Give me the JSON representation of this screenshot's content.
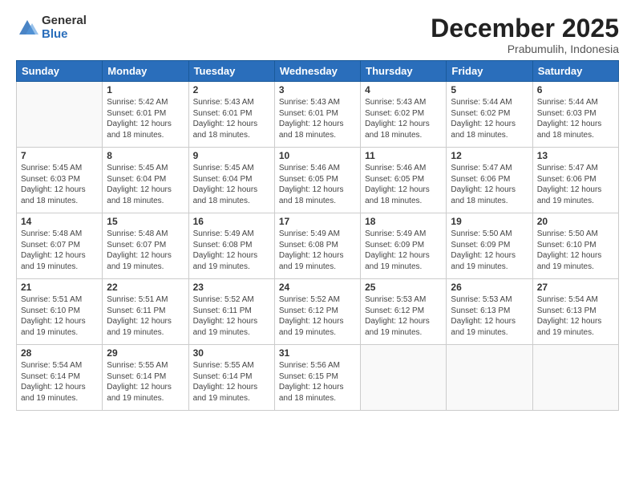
{
  "logo": {
    "general": "General",
    "blue": "Blue"
  },
  "header": {
    "title": "December 2025",
    "subtitle": "Prabumulih, Indonesia"
  },
  "days_of_week": [
    "Sunday",
    "Monday",
    "Tuesday",
    "Wednesday",
    "Thursday",
    "Friday",
    "Saturday"
  ],
  "weeks": [
    [
      {
        "day": "",
        "sunrise": "",
        "sunset": "",
        "daylight": ""
      },
      {
        "day": "1",
        "sunrise": "Sunrise: 5:42 AM",
        "sunset": "Sunset: 6:01 PM",
        "daylight": "Daylight: 12 hours and 18 minutes."
      },
      {
        "day": "2",
        "sunrise": "Sunrise: 5:43 AM",
        "sunset": "Sunset: 6:01 PM",
        "daylight": "Daylight: 12 hours and 18 minutes."
      },
      {
        "day": "3",
        "sunrise": "Sunrise: 5:43 AM",
        "sunset": "Sunset: 6:01 PM",
        "daylight": "Daylight: 12 hours and 18 minutes."
      },
      {
        "day": "4",
        "sunrise": "Sunrise: 5:43 AM",
        "sunset": "Sunset: 6:02 PM",
        "daylight": "Daylight: 12 hours and 18 minutes."
      },
      {
        "day": "5",
        "sunrise": "Sunrise: 5:44 AM",
        "sunset": "Sunset: 6:02 PM",
        "daylight": "Daylight: 12 hours and 18 minutes."
      },
      {
        "day": "6",
        "sunrise": "Sunrise: 5:44 AM",
        "sunset": "Sunset: 6:03 PM",
        "daylight": "Daylight: 12 hours and 18 minutes."
      }
    ],
    [
      {
        "day": "7",
        "sunrise": "Sunrise: 5:45 AM",
        "sunset": "Sunset: 6:03 PM",
        "daylight": "Daylight: 12 hours and 18 minutes."
      },
      {
        "day": "8",
        "sunrise": "Sunrise: 5:45 AM",
        "sunset": "Sunset: 6:04 PM",
        "daylight": "Daylight: 12 hours and 18 minutes."
      },
      {
        "day": "9",
        "sunrise": "Sunrise: 5:45 AM",
        "sunset": "Sunset: 6:04 PM",
        "daylight": "Daylight: 12 hours and 18 minutes."
      },
      {
        "day": "10",
        "sunrise": "Sunrise: 5:46 AM",
        "sunset": "Sunset: 6:05 PM",
        "daylight": "Daylight: 12 hours and 18 minutes."
      },
      {
        "day": "11",
        "sunrise": "Sunrise: 5:46 AM",
        "sunset": "Sunset: 6:05 PM",
        "daylight": "Daylight: 12 hours and 18 minutes."
      },
      {
        "day": "12",
        "sunrise": "Sunrise: 5:47 AM",
        "sunset": "Sunset: 6:06 PM",
        "daylight": "Daylight: 12 hours and 18 minutes."
      },
      {
        "day": "13",
        "sunrise": "Sunrise: 5:47 AM",
        "sunset": "Sunset: 6:06 PM",
        "daylight": "Daylight: 12 hours and 19 minutes."
      }
    ],
    [
      {
        "day": "14",
        "sunrise": "Sunrise: 5:48 AM",
        "sunset": "Sunset: 6:07 PM",
        "daylight": "Daylight: 12 hours and 19 minutes."
      },
      {
        "day": "15",
        "sunrise": "Sunrise: 5:48 AM",
        "sunset": "Sunset: 6:07 PM",
        "daylight": "Daylight: 12 hours and 19 minutes."
      },
      {
        "day": "16",
        "sunrise": "Sunrise: 5:49 AM",
        "sunset": "Sunset: 6:08 PM",
        "daylight": "Daylight: 12 hours and 19 minutes."
      },
      {
        "day": "17",
        "sunrise": "Sunrise: 5:49 AM",
        "sunset": "Sunset: 6:08 PM",
        "daylight": "Daylight: 12 hours and 19 minutes."
      },
      {
        "day": "18",
        "sunrise": "Sunrise: 5:49 AM",
        "sunset": "Sunset: 6:09 PM",
        "daylight": "Daylight: 12 hours and 19 minutes."
      },
      {
        "day": "19",
        "sunrise": "Sunrise: 5:50 AM",
        "sunset": "Sunset: 6:09 PM",
        "daylight": "Daylight: 12 hours and 19 minutes."
      },
      {
        "day": "20",
        "sunrise": "Sunrise: 5:50 AM",
        "sunset": "Sunset: 6:10 PM",
        "daylight": "Daylight: 12 hours and 19 minutes."
      }
    ],
    [
      {
        "day": "21",
        "sunrise": "Sunrise: 5:51 AM",
        "sunset": "Sunset: 6:10 PM",
        "daylight": "Daylight: 12 hours and 19 minutes."
      },
      {
        "day": "22",
        "sunrise": "Sunrise: 5:51 AM",
        "sunset": "Sunset: 6:11 PM",
        "daylight": "Daylight: 12 hours and 19 minutes."
      },
      {
        "day": "23",
        "sunrise": "Sunrise: 5:52 AM",
        "sunset": "Sunset: 6:11 PM",
        "daylight": "Daylight: 12 hours and 19 minutes."
      },
      {
        "day": "24",
        "sunrise": "Sunrise: 5:52 AM",
        "sunset": "Sunset: 6:12 PM",
        "daylight": "Daylight: 12 hours and 19 minutes."
      },
      {
        "day": "25",
        "sunrise": "Sunrise: 5:53 AM",
        "sunset": "Sunset: 6:12 PM",
        "daylight": "Daylight: 12 hours and 19 minutes."
      },
      {
        "day": "26",
        "sunrise": "Sunrise: 5:53 AM",
        "sunset": "Sunset: 6:13 PM",
        "daylight": "Daylight: 12 hours and 19 minutes."
      },
      {
        "day": "27",
        "sunrise": "Sunrise: 5:54 AM",
        "sunset": "Sunset: 6:13 PM",
        "daylight": "Daylight: 12 hours and 19 minutes."
      }
    ],
    [
      {
        "day": "28",
        "sunrise": "Sunrise: 5:54 AM",
        "sunset": "Sunset: 6:14 PM",
        "daylight": "Daylight: 12 hours and 19 minutes."
      },
      {
        "day": "29",
        "sunrise": "Sunrise: 5:55 AM",
        "sunset": "Sunset: 6:14 PM",
        "daylight": "Daylight: 12 hours and 19 minutes."
      },
      {
        "day": "30",
        "sunrise": "Sunrise: 5:55 AM",
        "sunset": "Sunset: 6:14 PM",
        "daylight": "Daylight: 12 hours and 19 minutes."
      },
      {
        "day": "31",
        "sunrise": "Sunrise: 5:56 AM",
        "sunset": "Sunset: 6:15 PM",
        "daylight": "Daylight: 12 hours and 18 minutes."
      },
      {
        "day": "",
        "sunrise": "",
        "sunset": "",
        "daylight": ""
      },
      {
        "day": "",
        "sunrise": "",
        "sunset": "",
        "daylight": ""
      },
      {
        "day": "",
        "sunrise": "",
        "sunset": "",
        "daylight": ""
      }
    ]
  ]
}
